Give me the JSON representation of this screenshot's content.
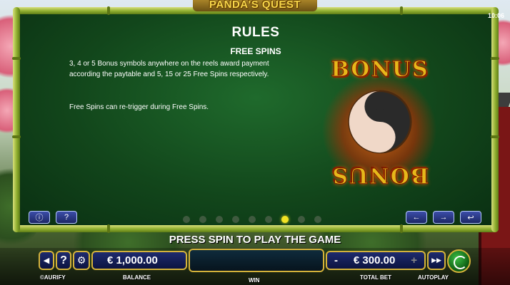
{
  "game": {
    "title": "PANDA'S QUEST",
    "clock": "10:06"
  },
  "rules": {
    "heading": "RULES",
    "subheading": "FREE SPINS",
    "paragraph1": "3, 4 or 5 Bonus symbols anywhere on the reels award payment according the paytable and 5, 15 or 25 Free Spins respectively.",
    "paragraph2": "Free Spins can re-trigger during Free Spins.",
    "symbol_text_top": "BONUS",
    "symbol_text_bottom": "BONUS",
    "page_count": 9,
    "active_page": 7
  },
  "panel_buttons": {
    "info_icon": "info-icon",
    "help_icon": "help-icon",
    "prev": "◄",
    "next": "►",
    "back": "↩"
  },
  "bottom_bar": {
    "prompt": "PRESS SPIN TO PLAY THE GAME",
    "balance_value": "€ 1,000.00",
    "balance_label": "BALANCE",
    "win_label": "WIN",
    "bet_minus": "-",
    "bet_value": "€ 300.00",
    "bet_plus": "+",
    "bet_label": "TOTAL BET",
    "autoplay_label": "AUTOPLAY",
    "brand": "©AURIFY",
    "help": "?",
    "sound_icon": "speaker-icon",
    "settings_icon": "gear-icon"
  },
  "colors": {
    "accent_gold": "#d4b23a",
    "panel_green": "#12461b",
    "active_dot": "#f1e224"
  }
}
